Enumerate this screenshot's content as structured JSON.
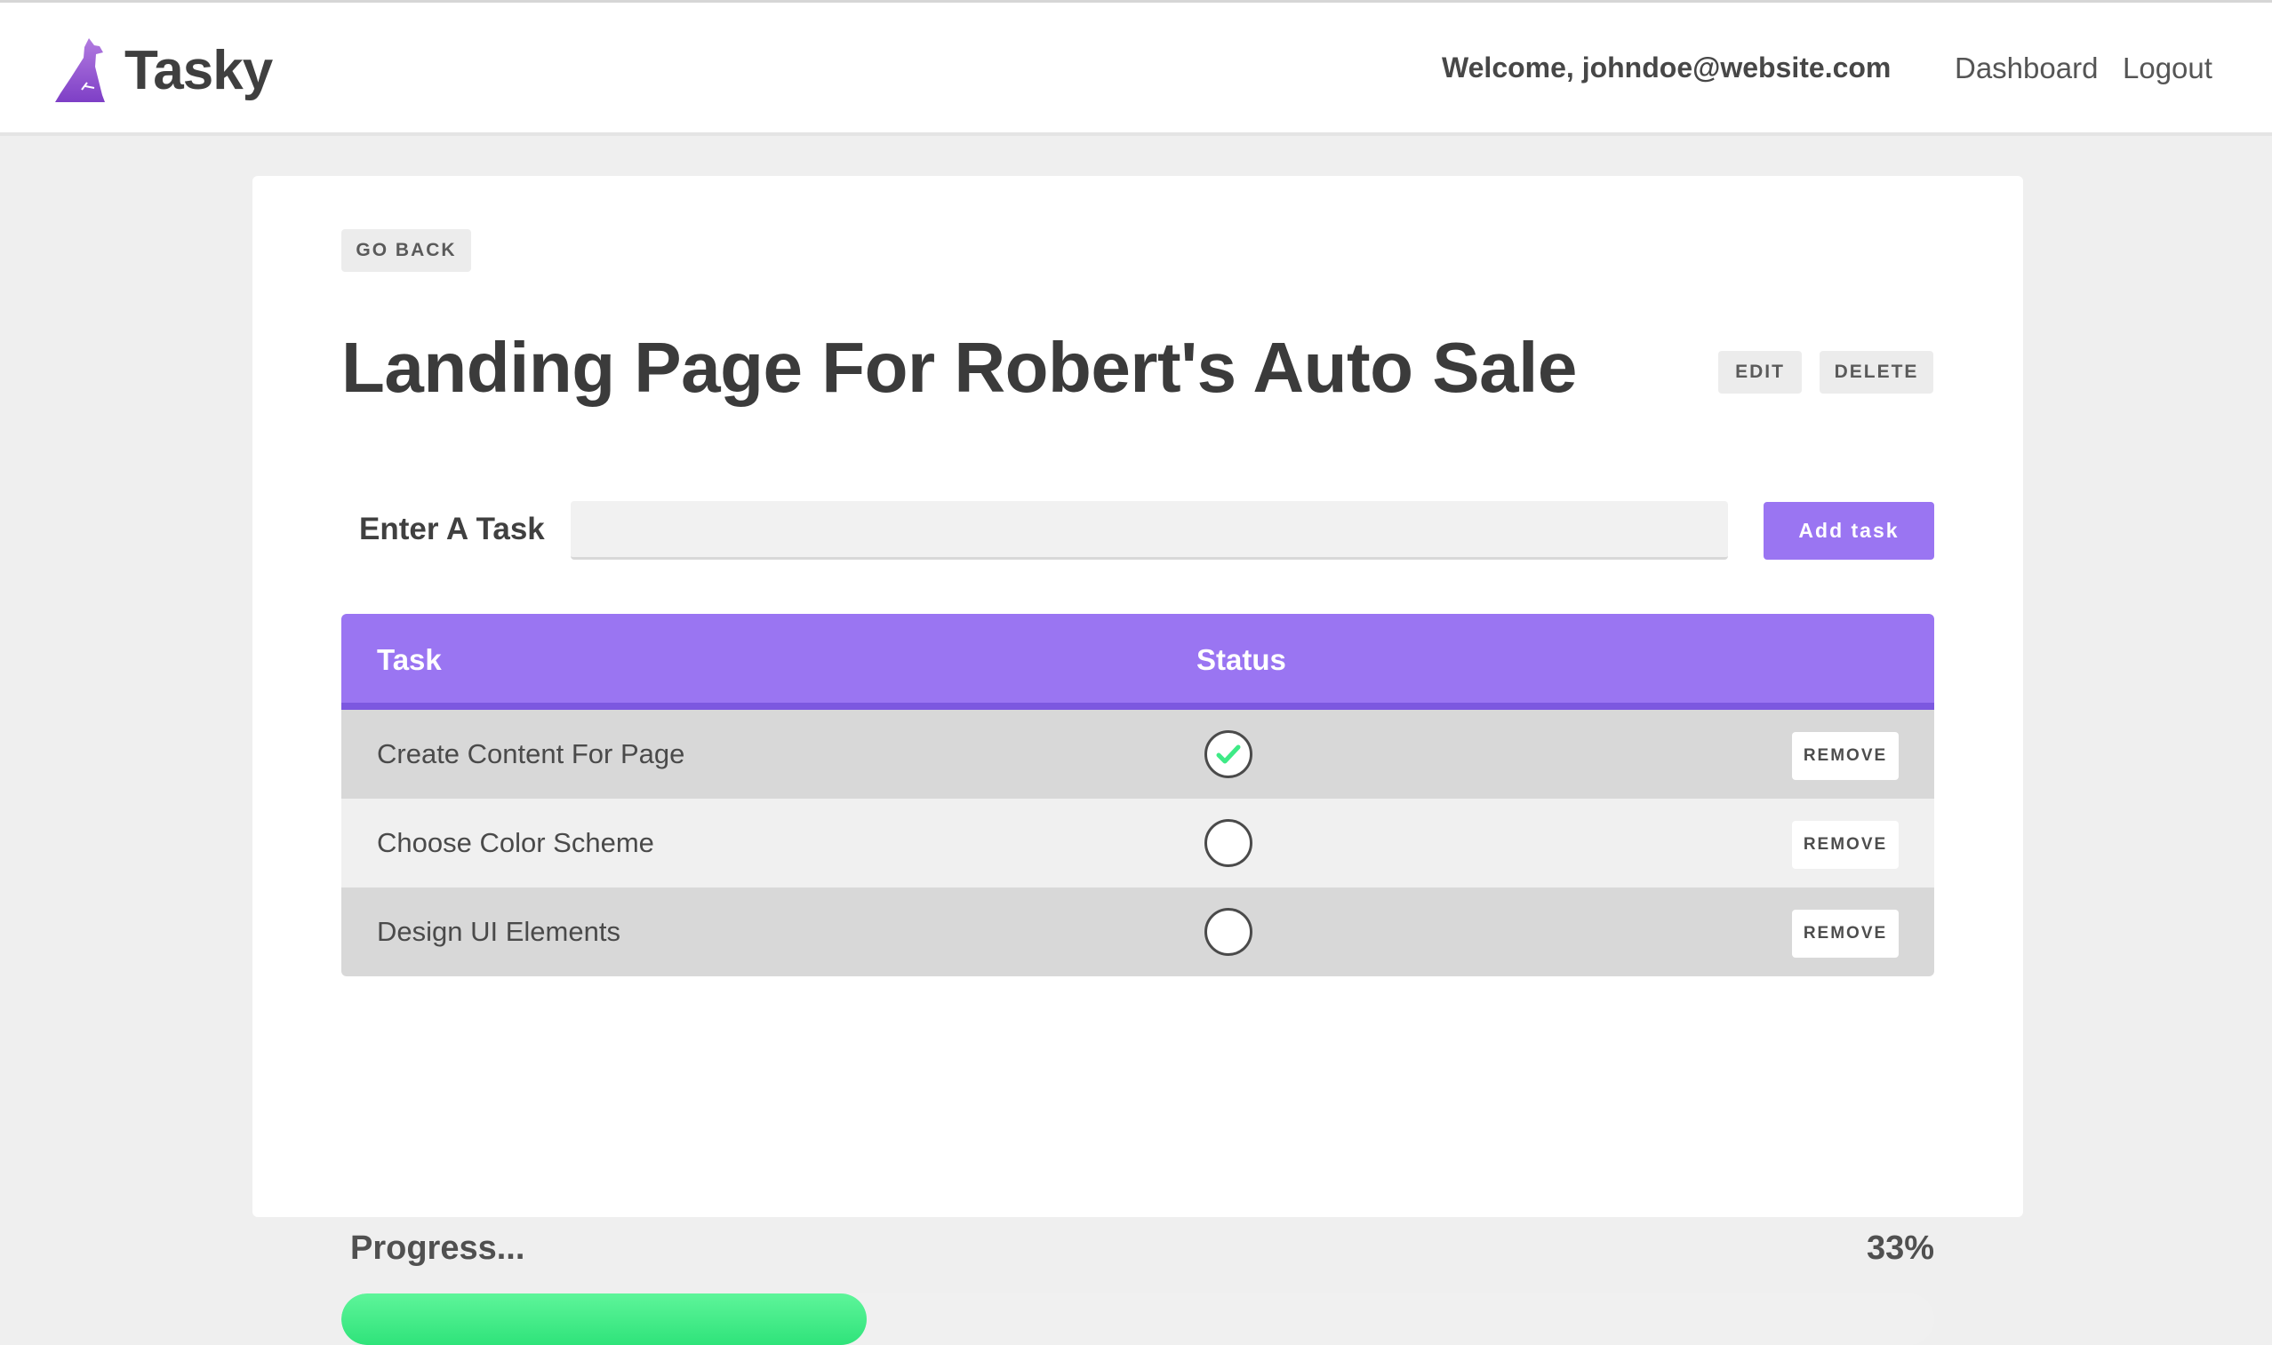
{
  "app": {
    "name": "Tasky",
    "brand_color": "#9a75f2"
  },
  "header": {
    "welcome_text": "Welcome, johndoe@website.com",
    "nav": [
      {
        "label": "Dashboard"
      },
      {
        "label": "Logout"
      }
    ]
  },
  "project": {
    "go_back_label": "GO BACK",
    "title": "Landing Page For Robert's Auto Sale",
    "edit_label": "EDIT",
    "delete_label": "DELETE"
  },
  "task_form": {
    "label": "Enter A Task",
    "value": "",
    "placeholder": "",
    "add_label": "Add task"
  },
  "table": {
    "headers": {
      "task": "Task",
      "status": "Status"
    },
    "remove_label": "REMOVE",
    "rows": [
      {
        "task": "Create Content For Page",
        "done": true,
        "status_icon": "check-icon"
      },
      {
        "task": "Choose Color Scheme",
        "done": false,
        "status_icon": ""
      },
      {
        "task": "Design UI Elements",
        "done": false,
        "status_icon": ""
      }
    ]
  },
  "progress": {
    "label": "Progress...",
    "percent_text": "33%",
    "value": 0.33,
    "fill_color": "#3eea86"
  }
}
